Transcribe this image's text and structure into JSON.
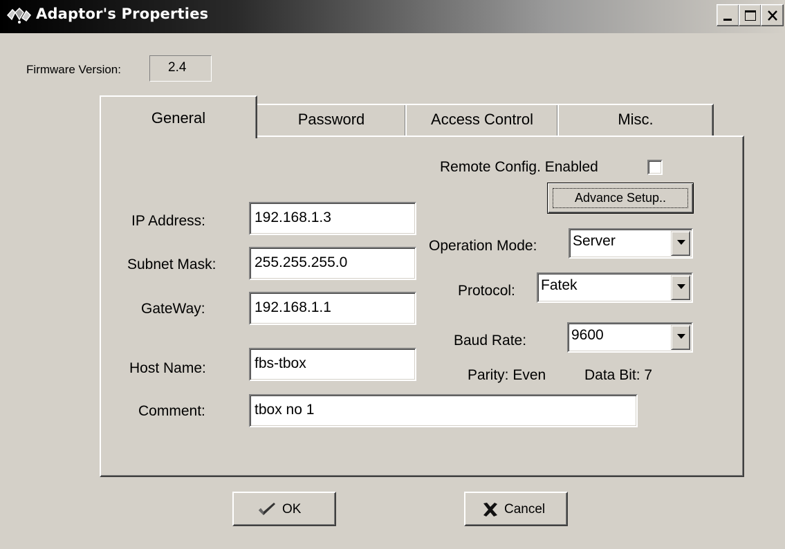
{
  "window": {
    "title": "Adaptor's Properties",
    "icon": "network-adaptor-icon",
    "controls": [
      "minimize-icon",
      "maximize-icon",
      "close-icon"
    ]
  },
  "firmware": {
    "label": "Firmware Version:",
    "value": "2.4"
  },
  "tabs": [
    {
      "label": "General",
      "active": true
    },
    {
      "label": "Password",
      "active": false
    },
    {
      "label": "Access Control",
      "active": false
    },
    {
      "label": "Misc.",
      "active": false
    }
  ],
  "general": {
    "remote_config_label": "Remote Config. Enabled",
    "remote_config_checked": false,
    "advance_setup_label": "Advance Setup..",
    "ip_label": "IP Address:",
    "ip_value": "192.168.1.3",
    "subnet_label": "Subnet Mask:",
    "subnet_value": "255.255.255.0",
    "gateway_label": "GateWay:",
    "gateway_value": "192.168.1.1",
    "host_label": "Host Name:",
    "host_value": "fbs-tbox",
    "comment_label": "Comment:",
    "comment_value": "tbox no 1",
    "operation_mode_label": "Operation Mode:",
    "operation_mode_value": "Server",
    "protocol_label": "Protocol:",
    "protocol_value": "Fatek",
    "baud_rate_label": "Baud Rate:",
    "baud_rate_value": "9600",
    "parity_text": "Parity: Even",
    "data_bit_text": "Data Bit: 7"
  },
  "buttons": {
    "ok_label": "OK",
    "ok_icon": "checkmark-icon",
    "cancel_label": "Cancel",
    "cancel_icon": "x-icon"
  },
  "colors": {
    "dialog_bg": "#d4d0c8",
    "title_start": "#000000",
    "title_end": "#d4d0c8"
  }
}
